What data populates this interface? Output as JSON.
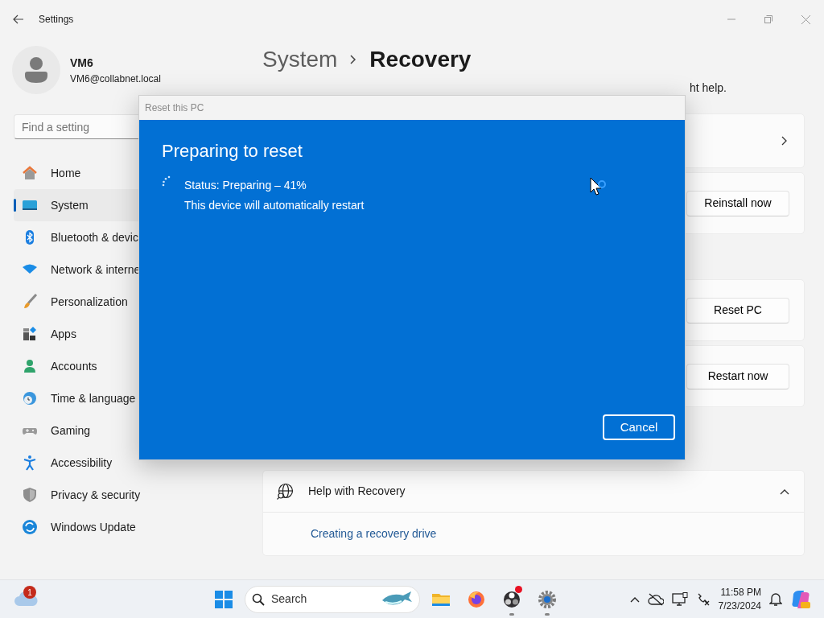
{
  "window": {
    "title": "Settings"
  },
  "user": {
    "name": "VM6",
    "email": "VM6@collabnet.local"
  },
  "search": {
    "placeholder": "Find a setting"
  },
  "sidebar": {
    "items": [
      {
        "label": "Home",
        "selected": false
      },
      {
        "label": "System",
        "selected": true
      },
      {
        "label": "Bluetooth & devic",
        "selected": false
      },
      {
        "label": "Network & interne",
        "selected": false
      },
      {
        "label": "Personalization",
        "selected": false
      },
      {
        "label": "Apps",
        "selected": false
      },
      {
        "label": "Accounts",
        "selected": false
      },
      {
        "label": "Time & language",
        "selected": false
      },
      {
        "label": "Gaming",
        "selected": false
      },
      {
        "label": "Accessibility",
        "selected": false
      },
      {
        "label": "Privacy & security",
        "selected": false
      },
      {
        "label": "Windows Update",
        "selected": false
      }
    ]
  },
  "breadcrumb": [
    "System",
    "Recovery"
  ],
  "description": "ht help.",
  "card_groups": [
    [
      {
        "kind": "link"
      },
      {
        "kind": "button",
        "button": "Reinstall now"
      }
    ],
    [
      {
        "kind": "button",
        "button": "Reset PC"
      },
      {
        "kind": "button",
        "button": "Restart now"
      }
    ]
  ],
  "help": {
    "title": "Help with Recovery",
    "expanded": true,
    "links": [
      "Creating a recovery drive"
    ]
  },
  "dialog": {
    "title": "Reset this PC",
    "heading": "Preparing to reset",
    "status": "Status: Preparing – 41%",
    "note": "This device will automatically restart",
    "button": "Cancel"
  },
  "taskbar": {
    "weather_badge": "1",
    "search_placeholder": "Search",
    "apps": [
      {
        "kind": "folder",
        "running": false,
        "alert": false
      },
      {
        "kind": "browser",
        "running": false,
        "alert": false
      },
      {
        "kind": "recorder",
        "running": true,
        "alert": true
      },
      {
        "kind": "settings",
        "running": true,
        "alert": false
      }
    ],
    "time": "11:58 PM",
    "date": "7/23/2024"
  }
}
